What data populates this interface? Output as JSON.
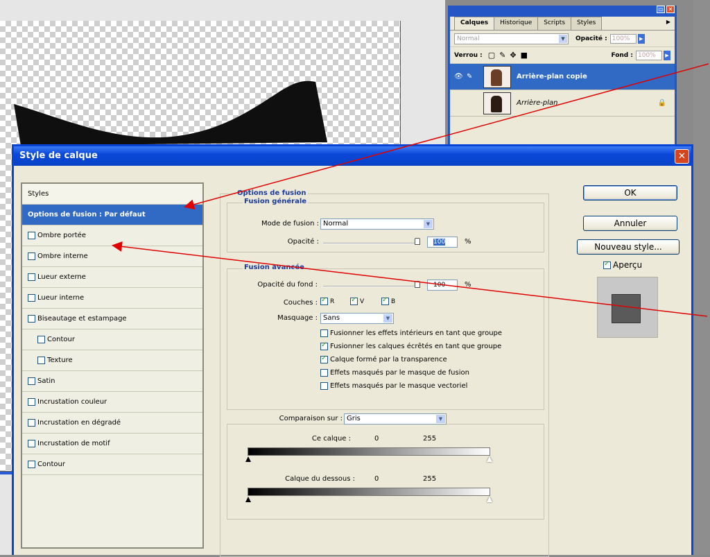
{
  "layers_panel": {
    "tabs": [
      "Calques",
      "Historique",
      "Scripts",
      "Styles"
    ],
    "blend_mode": "Normal",
    "opacity_label": "Opacité :",
    "opacity_value": "100%",
    "lock_label": "Verrou :",
    "fill_label": "Fond :",
    "fill_value": "100%",
    "layers": [
      {
        "name": "Arrière-plan copie",
        "selected": true
      },
      {
        "name": "Arrière-plan",
        "selected": false
      }
    ]
  },
  "dialog": {
    "title": "Style de calque",
    "close_glyph": "✕",
    "styles": {
      "header": "Styles",
      "active": "Options de fusion : Par défaut",
      "items": [
        {
          "label": "Ombre portée",
          "checked": false,
          "sub": false
        },
        {
          "label": "Ombre interne",
          "checked": false,
          "sub": false
        },
        {
          "label": "Lueur externe",
          "checked": false,
          "sub": false
        },
        {
          "label": "Lueur interne",
          "checked": false,
          "sub": false
        },
        {
          "label": "Biseautage et estampage",
          "checked": false,
          "sub": false
        },
        {
          "label": "Contour",
          "checked": false,
          "sub": true
        },
        {
          "label": "Texture",
          "checked": false,
          "sub": true
        },
        {
          "label": "Satin",
          "checked": false,
          "sub": false
        },
        {
          "label": "Incrustation couleur",
          "checked": false,
          "sub": false
        },
        {
          "label": "Incrustation en dégradé",
          "checked": false,
          "sub": false
        },
        {
          "label": "Incrustation de motif",
          "checked": false,
          "sub": false
        },
        {
          "label": "Contour",
          "checked": false,
          "sub": false
        }
      ]
    },
    "fusion": {
      "section_title": "Options de fusion",
      "general_title": "Fusion générale",
      "mode_label": "Mode de fusion :",
      "mode_value": "Normal",
      "opacity_label": "Opacité :",
      "opacity_value": "100",
      "percent": "%",
      "advanced_title": "Fusion avancée",
      "fill_opacity_label": "Opacité du fond :",
      "fill_opacity_value": "100",
      "channels_label": "Couches :",
      "channels": [
        "R",
        "V",
        "B"
      ],
      "knockout_label": "Masquage :",
      "knockout_value": "Sans",
      "options": [
        {
          "label": "Fusionner les effets intérieurs en tant que groupe",
          "checked": false
        },
        {
          "label": "Fusionner les calques écrêtés en tant que groupe",
          "checked": true
        },
        {
          "label": "Calque formé par la transparence",
          "checked": true
        },
        {
          "label": "Effets masqués par le masque de fusion",
          "checked": false
        },
        {
          "label": "Effets masqués par le masque vectoriel",
          "checked": false
        }
      ],
      "blend_if_label": "Comparaison sur :",
      "blend_if_value": "Gris",
      "this_layer_label": "Ce calque :",
      "this_layer_min": "0",
      "this_layer_max": "255",
      "underlying_label": "Calque du dessous :",
      "underlying_min": "0",
      "underlying_max": "255"
    },
    "buttons": {
      "ok": "OK",
      "cancel": "Annuler",
      "new_style": "Nouveau style...",
      "preview": "Aperçu"
    }
  }
}
